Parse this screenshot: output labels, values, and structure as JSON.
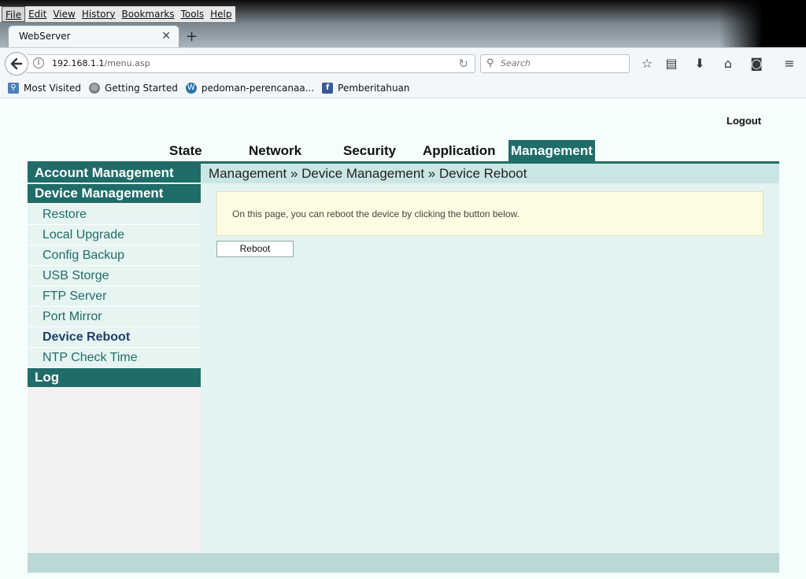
{
  "browser": {
    "menu": [
      "File",
      "Edit",
      "View",
      "History",
      "Bookmarks",
      "Tools",
      "Help"
    ],
    "tab_title": "WebServer",
    "url_host": "192.168.1.1",
    "url_path": "/menu.asp",
    "search_placeholder": "Search",
    "bookmarks": [
      "Most Visited",
      "Getting Started",
      "pedoman-perencanaa...",
      "Pemberitahuan"
    ]
  },
  "header": {
    "logout_label": "Logout",
    "tabs": [
      "State",
      "Network",
      "Security",
      "Application",
      "Management"
    ],
    "active_tab": "Management"
  },
  "sidebar": {
    "groups": [
      "Account Management",
      "Device Management",
      "Log"
    ],
    "items": [
      "Restore",
      "Local Upgrade",
      "Config Backup",
      "USB Storge",
      "FTP Server",
      "Port Mirror",
      "Device Reboot",
      "NTP Check Time"
    ],
    "current_item": "Device Reboot"
  },
  "main": {
    "breadcrumb": "Management » Device Management » Device Reboot",
    "info_text": "On this page, you can reboot the device by clicking the button below.",
    "reboot_label": "Reboot"
  },
  "colors": {
    "accent": "#206c69",
    "panel_bg": "#e3f3f1",
    "breadcrumb_bg": "#cae6e4",
    "info_bg": "#fefde4",
    "current_item_color": "#1f3f67"
  }
}
